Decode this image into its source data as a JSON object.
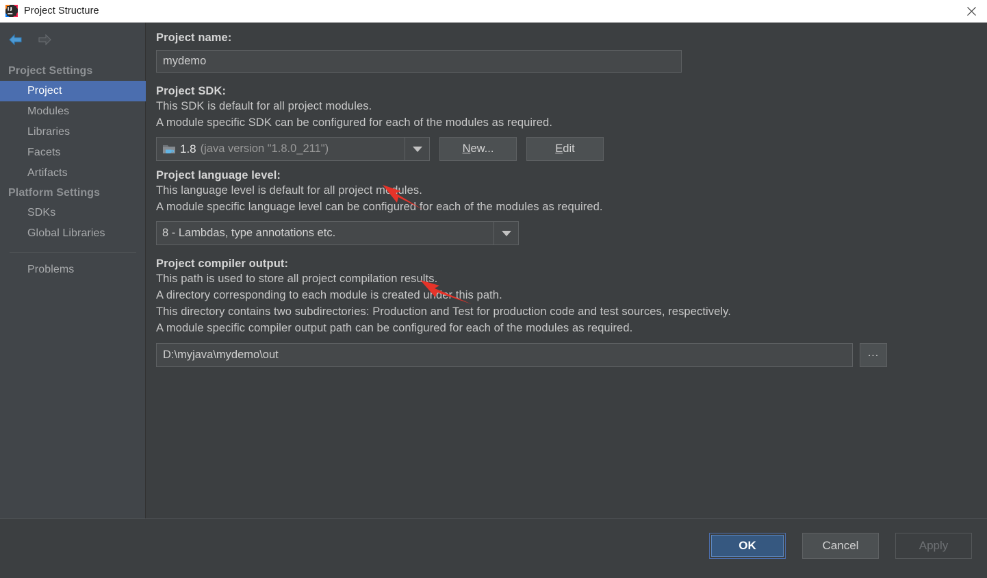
{
  "window": {
    "title": "Project Structure",
    "app_icon": "intellij-idea-logo",
    "close_icon": "close-icon"
  },
  "sidebar": {
    "back_icon": "arrow-back-icon",
    "forward_icon": "arrow-forward-icon",
    "groups": [
      {
        "label": "Project Settings",
        "items": [
          {
            "label": "Project",
            "selected": true
          },
          {
            "label": "Modules",
            "selected": false
          },
          {
            "label": "Libraries",
            "selected": false
          },
          {
            "label": "Facets",
            "selected": false
          },
          {
            "label": "Artifacts",
            "selected": false
          }
        ]
      },
      {
        "label": "Platform Settings",
        "items": [
          {
            "label": "SDKs",
            "selected": false
          },
          {
            "label": "Global Libraries",
            "selected": false
          }
        ]
      }
    ],
    "extra_items": [
      {
        "label": "Problems",
        "selected": false
      }
    ]
  },
  "main": {
    "project_name": {
      "label": "Project name:",
      "value": "mydemo"
    },
    "project_sdk": {
      "label": "Project SDK:",
      "descriptions": [
        "This SDK is default for all project modules.",
        "A module specific SDK can be configured for each of the modules as required."
      ],
      "icon": "jdk-folder-icon",
      "version": "1.8",
      "detail": "(java version \"1.8.0_211\")",
      "dropdown_icon": "chevron-down-icon",
      "new_button": {
        "prefix": "",
        "mnemonic": "N",
        "suffix": "ew..."
      },
      "edit_button": {
        "prefix": "",
        "mnemonic": "E",
        "suffix": "dit"
      }
    },
    "language_level": {
      "label": "Project language level:",
      "descriptions": [
        "This language level is default for all project modules.",
        "A module specific language level can be configured for each of the modules as required."
      ],
      "value": "8 - Lambdas, type annotations etc.",
      "dropdown_icon": "chevron-down-icon"
    },
    "compiler_output": {
      "label": "Project compiler output:",
      "descriptions": [
        "This path is used to store all project compilation results.",
        "A directory corresponding to each module is created under this path.",
        "This directory contains two subdirectories: Production and Test for production code and test sources, respectively.",
        "A module specific compiler output path can be configured for each of the modules as required."
      ],
      "value": "D:\\myjava\\mydemo\\out",
      "browse_label": "...",
      "browse_icon": "ellipsis-icon"
    }
  },
  "footer": {
    "ok_label": "OK",
    "cancel_label": "Cancel",
    "apply_label": "Apply"
  },
  "annotations": {
    "arrow_color": "#e63329",
    "arrow_sdk": "red-arrow-pointing-to-sdk-combo",
    "arrow_language_level": "red-arrow-pointing-to-language-level-combo"
  },
  "colors": {
    "titlebar_bg": "#ffffff",
    "dialog_bg": "#3c3f41",
    "sidebar_bg": "#414549",
    "selection_blue": "#4b6eaf",
    "primary_button": "#365880",
    "field_bg": "#45484a",
    "border": "#5e6163"
  }
}
